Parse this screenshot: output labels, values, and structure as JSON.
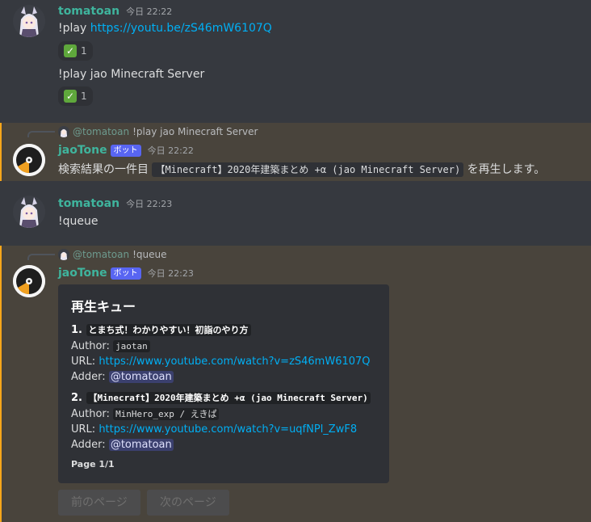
{
  "messages": [
    {
      "author": "tomatoan",
      "time": "今日 22:22",
      "text1_prefix": "!play ",
      "text1_link": "https://youtu.be/zS46mW6107Q",
      "reaction1_count": "1",
      "text2": "!play jao Minecraft Server",
      "reaction2_count": "1"
    },
    {
      "reply_mention": "@tomatoan",
      "reply_text": "!play jao Minecraft Server",
      "author": "jaoTone",
      "bot_tag": "ボット",
      "time": "今日 22:22",
      "text_prefix": "検索結果の一件目",
      "text_code": "【Minecraft】2020年建築まとめ +α (jao Minecraft Server)",
      "text_suffix": "を再生します。"
    },
    {
      "author": "tomatoan",
      "time": "今日 22:23",
      "text": "!queue"
    },
    {
      "reply_mention": "@tomatoan",
      "reply_text": "!queue",
      "author": "jaoTone",
      "bot_tag": "ボット",
      "time": "今日 22:23"
    }
  ],
  "embed": {
    "title": "再生キュー",
    "items": [
      {
        "num": "1.",
        "title": "とまち式！わかりやすい！初詣のやり方",
        "author_label": "Author:",
        "author": "jaotan",
        "url_label": "URL:",
        "url": "https://www.youtube.com/watch?v=zS46mW6107Q",
        "adder_label": "Adder:",
        "adder": "@tomatoan"
      },
      {
        "num": "2.",
        "title": "【Minecraft】2020年建築まとめ +α (jao Minecraft Server)",
        "author_label": "Author:",
        "author": "MinHero_exp / えきぱ",
        "url_label": "URL:",
        "url": "https://www.youtube.com/watch?v=uqfNPl_ZwF8",
        "adder_label": "Adder:",
        "adder": "@tomatoan"
      }
    ],
    "footer": "Page 1/1"
  },
  "buttons": {
    "prev": "前のページ",
    "next": "次のページ"
  },
  "colors": {
    "background": "#36393f",
    "highlight": "#49443c",
    "accent_bar": "#faa61a",
    "username": "#3fb49d",
    "link": "#00aff4",
    "bot_tag": "#5865f2"
  }
}
